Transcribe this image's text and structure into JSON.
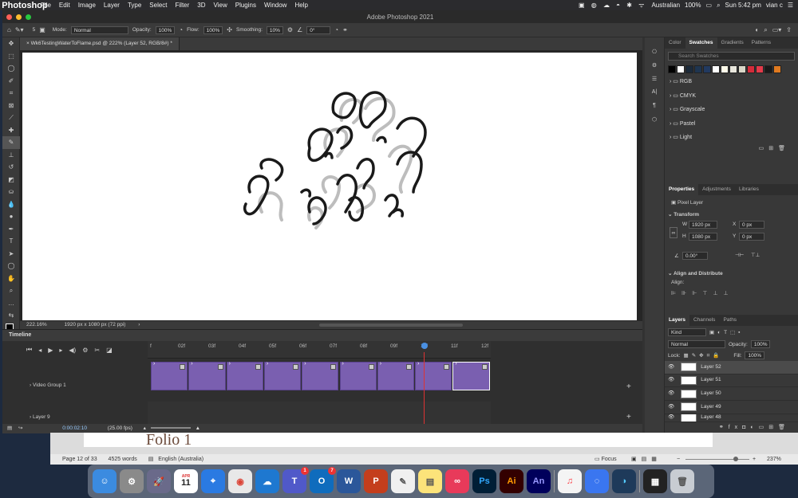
{
  "menubar": {
    "app": "Photoshop",
    "items": [
      "File",
      "Edit",
      "Image",
      "Layer",
      "Type",
      "Select",
      "Filter",
      "3D",
      "View",
      "Plugins",
      "Window",
      "Help"
    ],
    "language": "Australian",
    "battery": "100%",
    "datetime": "Sun 5:42 pm",
    "user": "vian c"
  },
  "window": {
    "title": "Adobe Photoshop 2021"
  },
  "options": {
    "brush_size": "5",
    "mode_label": "Mode:",
    "mode_value": "Normal",
    "opacity_label": "Opacity:",
    "opacity_value": "100%",
    "flow_label": "Flow:",
    "flow_value": "100%",
    "smoothing_label": "Smoothing:",
    "smoothing_value": "10%",
    "angle_value": "0°"
  },
  "document": {
    "tab_title": "Wk6TestingWaterToFlame.psd @ 222% (Layer 52, RGB/8#) *",
    "zoom": "222.16%",
    "dimensions": "1920 px x 1080 px (72 ppi)"
  },
  "timeline": {
    "title": "Timeline",
    "ticks": [
      "f",
      "02f",
      "03f",
      "04f",
      "05f",
      "06f",
      "07f",
      "08f",
      "09f",
      "10f",
      "11f",
      "12f"
    ],
    "tracks": [
      "Video Group 1",
      "Layer 9"
    ],
    "timecode": "0:00:02:10",
    "fps": "(25.00 fps)",
    "clip_count": 9,
    "selected_clip": 8
  },
  "swatches_panel": {
    "tabs": [
      "Color",
      "Swatches",
      "Gradients",
      "Patterns"
    ],
    "active_tab": "Swatches",
    "search_placeholder": "Search Swatches",
    "colors": [
      "#000000",
      "#ffffff",
      "#1b2a3a",
      "#1f3550",
      "#223a60",
      "#ffffff",
      "#fffbea",
      "#e8e6dc",
      "#d9d7c8",
      "#d42b3a",
      "#e43b4a",
      "#1a1a1a",
      "#e07a20"
    ],
    "folders": [
      "RGB",
      "CMYK",
      "Grayscale",
      "Pastel",
      "Light"
    ]
  },
  "properties_panel": {
    "tabs": [
      "Properties",
      "Adjustments",
      "Libraries"
    ],
    "kind": "Pixel Layer",
    "transform_label": "Transform",
    "w_label": "W",
    "w_value": "1920 px",
    "h_label": "H",
    "h_value": "1080 px",
    "x_label": "X",
    "x_value": "0 px",
    "y_label": "Y",
    "y_value": "0 px",
    "angle": "0.00°",
    "align_label": "Align and Distribute",
    "align_sub": "Align:"
  },
  "layers_panel": {
    "tabs": [
      "Layers",
      "Channels",
      "Paths"
    ],
    "filter": "Kind",
    "blend": "Normal",
    "opacity_label": "Opacity:",
    "opacity_value": "100%",
    "lock_label": "Lock:",
    "fill_label": "Fill:",
    "fill_value": "100%",
    "layers": [
      "Layer 52",
      "Layer 51",
      "Layer 50",
      "Layer 49",
      "Layer 48"
    ]
  },
  "word": {
    "doc_text": "Folio 1",
    "page": "Page 12 of 33",
    "words": "4525 words",
    "language": "English (Australia)",
    "focus": "Focus",
    "zoom": "237%"
  },
  "dock": {
    "calendar_month": "APR",
    "calendar_day": "11",
    "teams_badge": "1",
    "outlook_badge": "7",
    "ps_label": "Ps",
    "ai_label": "Ai",
    "an_label": "An"
  }
}
